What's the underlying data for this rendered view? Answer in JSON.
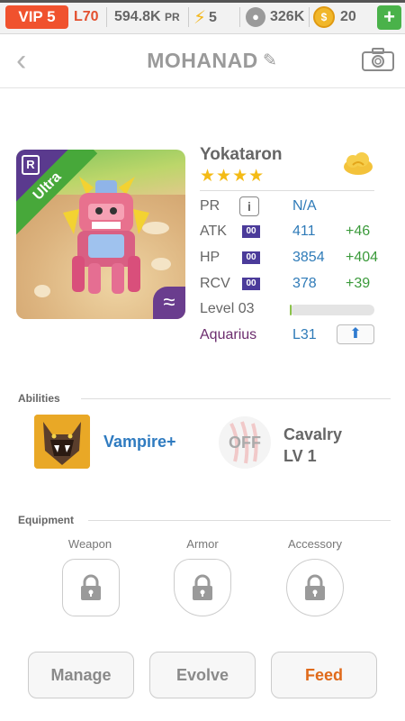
{
  "status_bar": {
    "vip": "VIP 5",
    "level": "L70",
    "power": "594.8K",
    "power_unit": "PR",
    "energy": "5",
    "food": "326K",
    "coins": "20",
    "add_label": "+"
  },
  "header": {
    "title": "MOHANAD"
  },
  "monster": {
    "name": "Yokataron",
    "stars": "★★★★",
    "rarity": "Ultra",
    "rank_badge": "R",
    "element_symbol": "≈",
    "stats": {
      "pr_label": "PR",
      "pr_value": "N/A",
      "info_label": "i",
      "atk_label": "ATK",
      "atk_chip": "00",
      "atk_value": "411",
      "atk_bonus": "+46",
      "hp_label": "HP",
      "hp_chip": "00",
      "hp_value": "3854",
      "hp_bonus": "+404",
      "rcv_label": "RCV",
      "rcv_chip": "00",
      "rcv_value": "378",
      "rcv_bonus": "+39",
      "level_label": "Level 03",
      "level_progress": 0.02,
      "zodiac": "Aquarius",
      "zodiac_level": "L31"
    }
  },
  "abilities": {
    "title": "Abilities",
    "ability_name": "Vampire+",
    "off_label": "OFF",
    "second_name": "Cavalry",
    "second_level": "LV 1"
  },
  "equipment": {
    "title": "Equipment",
    "slots": [
      "Weapon",
      "Armor",
      "Accessory"
    ]
  },
  "actions": {
    "manage": "Manage",
    "evolve": "Evolve",
    "feed": "Feed"
  },
  "colors": {
    "vip": "#f0522e",
    "stat_value": "#2f7bb8",
    "stat_bonus": "#3b9a3b",
    "feed": "#e06a1a"
  }
}
